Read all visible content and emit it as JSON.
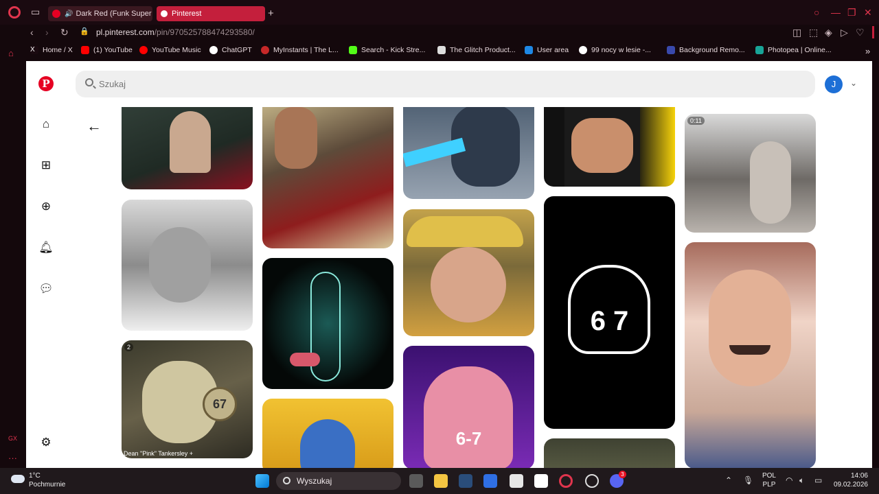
{
  "browser": {
    "tabs": [
      {
        "title": "Dark Red (Funk Super"
      },
      {
        "title": "Pinterest"
      }
    ],
    "new_tab_label": "+",
    "url": {
      "host": "pl.pinterest.com",
      "path": "/pin/970525788474293580/"
    },
    "bookmarks": [
      {
        "label": "Home / X",
        "color": "#000000"
      },
      {
        "label": "(1) YouTube",
        "color": "#ff0000"
      },
      {
        "label": "YouTube Music",
        "color": "#ff0000"
      },
      {
        "label": "ChatGPT",
        "color": "#ffffff"
      },
      {
        "label": "MyInstants | The L...",
        "color": "#c62828"
      },
      {
        "label": "Search - Kick Stre...",
        "color": "#53fc18"
      },
      {
        "label": "The Glitch Product...",
        "color": "#dddddd"
      },
      {
        "label": "User area",
        "color": "#1e88e5"
      },
      {
        "label": "99 nocy w lesie -...",
        "color": "#ffffff"
      },
      {
        "label": "Background Remo...",
        "color": "#3949ab"
      },
      {
        "label": "Photopea | Online...",
        "color": "#18a497"
      }
    ]
  },
  "pinterest": {
    "search_placeholder": "Szukaj",
    "avatar_letter": "J",
    "pins": {
      "rabbit_badge": "2",
      "rabbit_clock": "67",
      "rabbit_caption": "Dean \"Pink\" Tankersley +",
      "pig_shirt": "6-7",
      "bw_face_text": "6  7",
      "crowd_badge": "0:11"
    }
  },
  "taskbar": {
    "weather_temp": "1°C",
    "weather_desc": "Pochmurnie",
    "search_label": "Wyszukaj",
    "lang_top": "POL",
    "lang_bottom": "PLP",
    "time": "14:06",
    "date": "09.02.2026",
    "discord_badge": "3"
  },
  "colors": {
    "accent": "#e60023",
    "tab_active": "#c41f3c",
    "frame": "#14080c"
  }
}
